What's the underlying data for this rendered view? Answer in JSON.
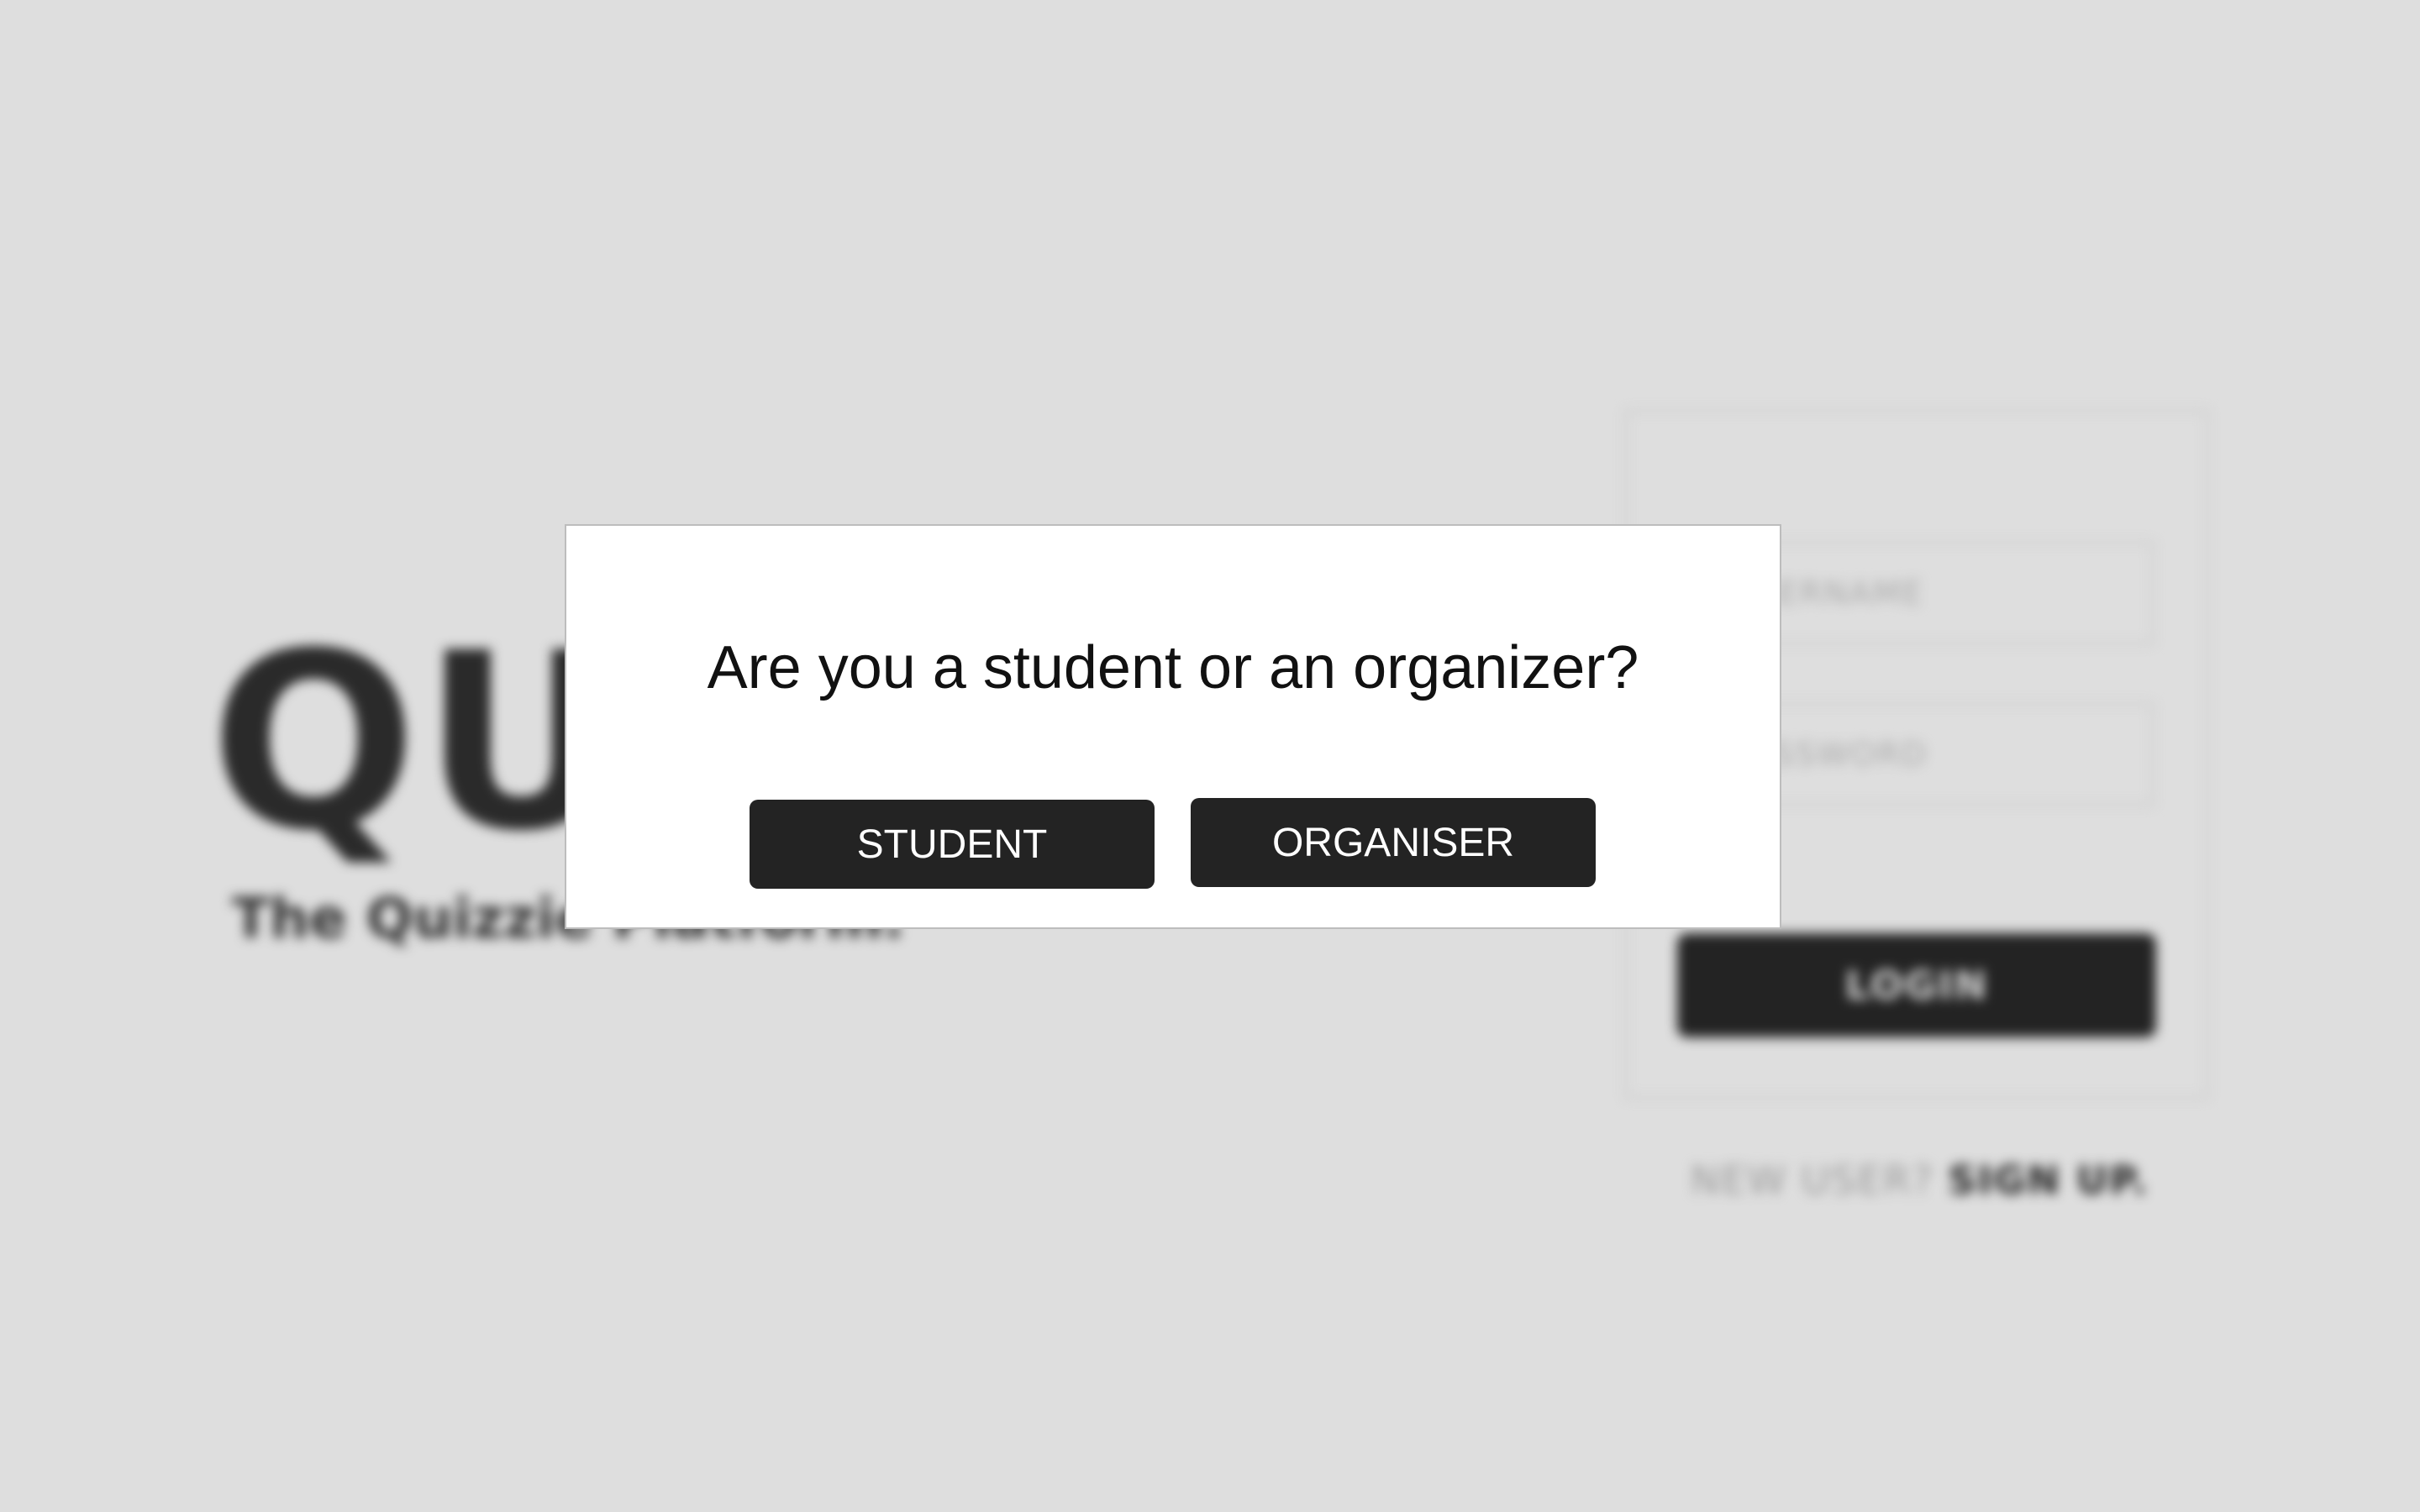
{
  "background": {
    "logo_text": "QUIZZIE",
    "tagline": "The Quizzie Platform.",
    "login_form": {
      "username_placeholder": "USERNAME",
      "password_placeholder": "PASSWORD",
      "login_label": "LOGIN"
    },
    "signup": {
      "question": "NEW USER?",
      "link_label": "SIGN UP."
    }
  },
  "modal": {
    "title": "Are you a student or an organizer?",
    "student_label": "STUDENT",
    "organiser_label": "ORGANISER"
  },
  "colors": {
    "page_background": "#dedede",
    "button_dark": "#232323",
    "modal_background": "#ffffff"
  }
}
